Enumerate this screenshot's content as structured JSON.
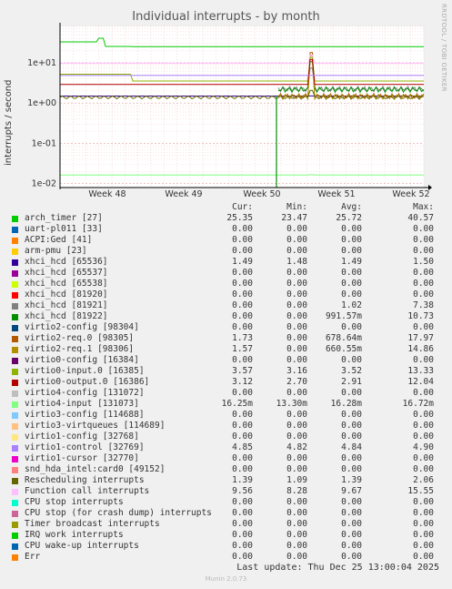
{
  "chart_data": {
    "type": "line",
    "title": "Individual interrupts - by month",
    "ylabel": "interrupts / second",
    "yscale": "log",
    "ylim": [
      0.008,
      80
    ],
    "yticks": [
      {
        "value": 0.01,
        "label": "1e-02"
      },
      {
        "value": 0.1,
        "label": "1e-01"
      },
      {
        "value": 1,
        "label": "1e+00"
      },
      {
        "value": 10,
        "label": "1e+01"
      }
    ],
    "xlabels": [
      "Week 48",
      "Week 49",
      "Week 50",
      "Week 51",
      "Week 52"
    ],
    "grid": true,
    "legend_placement": "bottom",
    "legend_headers": [
      "Cur:",
      "Min:",
      "Avg:",
      "Max:"
    ],
    "series": [
      {
        "name": "arch_timer [27]",
        "color": "#00cc00",
        "cur": "25.35",
        "min": "23.47",
        "avg": "25.72",
        "max": "40.57"
      },
      {
        "name": "uart-pl011 [33]",
        "color": "#0066b3",
        "cur": "0.00",
        "min": "0.00",
        "avg": "0.00",
        "max": "0.00"
      },
      {
        "name": "ACPI:Ged [41]",
        "color": "#ff8000",
        "cur": "0.00",
        "min": "0.00",
        "avg": "0.00",
        "max": "0.00"
      },
      {
        "name": "arm-pmu [23]",
        "color": "#ffcc00",
        "cur": "0.00",
        "min": "0.00",
        "avg": "0.00",
        "max": "0.00"
      },
      {
        "name": "xhci_hcd [65536]",
        "color": "#330099",
        "cur": "1.49",
        "min": "1.48",
        "avg": "1.49",
        "max": "1.50"
      },
      {
        "name": "xhci_hcd [65537]",
        "color": "#990099",
        "cur": "0.00",
        "min": "0.00",
        "avg": "0.00",
        "max": "0.00"
      },
      {
        "name": "xhci_hcd [65538]",
        "color": "#ccff00",
        "cur": "0.00",
        "min": "0.00",
        "avg": "0.00",
        "max": "0.00"
      },
      {
        "name": "xhci_hcd [81920]",
        "color": "#ff0000",
        "cur": "0.00",
        "min": "0.00",
        "avg": "0.00",
        "max": "0.00"
      },
      {
        "name": "xhci_hcd [81921]",
        "color": "#808080",
        "cur": "0.00",
        "min": "0.00",
        "avg": "1.02",
        "max": "7.38"
      },
      {
        "name": "xhci_hcd [81922]",
        "color": "#008f00",
        "cur": "0.00",
        "min": "0.00",
        "avg": "991.57m",
        "max": "10.73"
      },
      {
        "name": "virtio2-config [98304]",
        "color": "#00487d",
        "cur": "0.00",
        "min": "0.00",
        "avg": "0.00",
        "max": "0.00"
      },
      {
        "name": "virtio2-req.0 [98305]",
        "color": "#b35a00",
        "cur": "1.73",
        "min": "0.00",
        "avg": "678.64m",
        "max": "17.97"
      },
      {
        "name": "virtio2-req.1 [98306]",
        "color": "#b38f00",
        "cur": "1.57",
        "min": "0.00",
        "avg": "660.55m",
        "max": "14.86"
      },
      {
        "name": "virtio0-config [16384]",
        "color": "#6b006b",
        "cur": "0.00",
        "min": "0.00",
        "avg": "0.00",
        "max": "0.00"
      },
      {
        "name": "virtio0-input.0 [16385]",
        "color": "#8fb300",
        "cur": "3.57",
        "min": "3.16",
        "avg": "3.52",
        "max": "13.33"
      },
      {
        "name": "virtio0-output.0 [16386]",
        "color": "#b30000",
        "cur": "3.12",
        "min": "2.70",
        "avg": "2.91",
        "max": "12.04"
      },
      {
        "name": "virtio4-config [131072]",
        "color": "#bebebe",
        "cur": "0.00",
        "min": "0.00",
        "avg": "0.00",
        "max": "0.00"
      },
      {
        "name": "virtio4-input [131073]",
        "color": "#80ff80",
        "cur": "16.25m",
        "min": "13.30m",
        "avg": "16.28m",
        "max": "16.72m"
      },
      {
        "name": "virtio3-config [114688]",
        "color": "#80c9ff",
        "cur": "0.00",
        "min": "0.00",
        "avg": "0.00",
        "max": "0.00"
      },
      {
        "name": "virtio3-virtqueues [114689]",
        "color": "#ffc080",
        "cur": "0.00",
        "min": "0.00",
        "avg": "0.00",
        "max": "0.00"
      },
      {
        "name": "virtio1-config [32768]",
        "color": "#ffe680",
        "cur": "0.00",
        "min": "0.00",
        "avg": "0.00",
        "max": "0.00"
      },
      {
        "name": "virtio1-control [32769]",
        "color": "#aa80ff",
        "cur": "4.85",
        "min": "4.82",
        "avg": "4.84",
        "max": "4.90"
      },
      {
        "name": "virtio1-cursor [32770]",
        "color": "#ee00cc",
        "cur": "0.00",
        "min": "0.00",
        "avg": "0.00",
        "max": "0.00"
      },
      {
        "name": "snd_hda_intel:card0 [49152]",
        "color": "#ff8080",
        "cur": "0.00",
        "min": "0.00",
        "avg": "0.00",
        "max": "0.00"
      },
      {
        "name": "Rescheduling interrupts",
        "color": "#666600",
        "cur": "1.39",
        "min": "1.09",
        "avg": "1.39",
        "max": "2.06"
      },
      {
        "name": "Function call interrupts",
        "color": "#ffbfff",
        "cur": "9.56",
        "min": "8.28",
        "avg": "9.67",
        "max": "15.55"
      },
      {
        "name": "CPU stop interrupts",
        "color": "#00ffcc",
        "cur": "0.00",
        "min": "0.00",
        "avg": "0.00",
        "max": "0.00"
      },
      {
        "name": "CPU stop (for crash dump) interrupts",
        "color": "#cc6699",
        "cur": "0.00",
        "min": "0.00",
        "avg": "0.00",
        "max": "0.00"
      },
      {
        "name": "Timer broadcast interrupts",
        "color": "#999900",
        "cur": "0.00",
        "min": "0.00",
        "avg": "0.00",
        "max": "0.00"
      },
      {
        "name": "IRQ work interrupts",
        "color": "#00cc00",
        "cur": "0.00",
        "min": "0.00",
        "avg": "0.00",
        "max": "0.00"
      },
      {
        "name": "CPU wake-up interrupts",
        "color": "#0066b3",
        "cur": "0.00",
        "min": "0.00",
        "avg": "0.00",
        "max": "0.00"
      },
      {
        "name": "Err",
        "color": "#ff8000",
        "cur": "0.00",
        "min": "0.00",
        "avg": "0.00",
        "max": "0.00"
      }
    ]
  },
  "side_text": "RRDTOOL / TOBI OETIKER",
  "footer": "Last update: Thu Dec 25 13:00:04 2025",
  "munin_version": "Munin 2.0.73"
}
